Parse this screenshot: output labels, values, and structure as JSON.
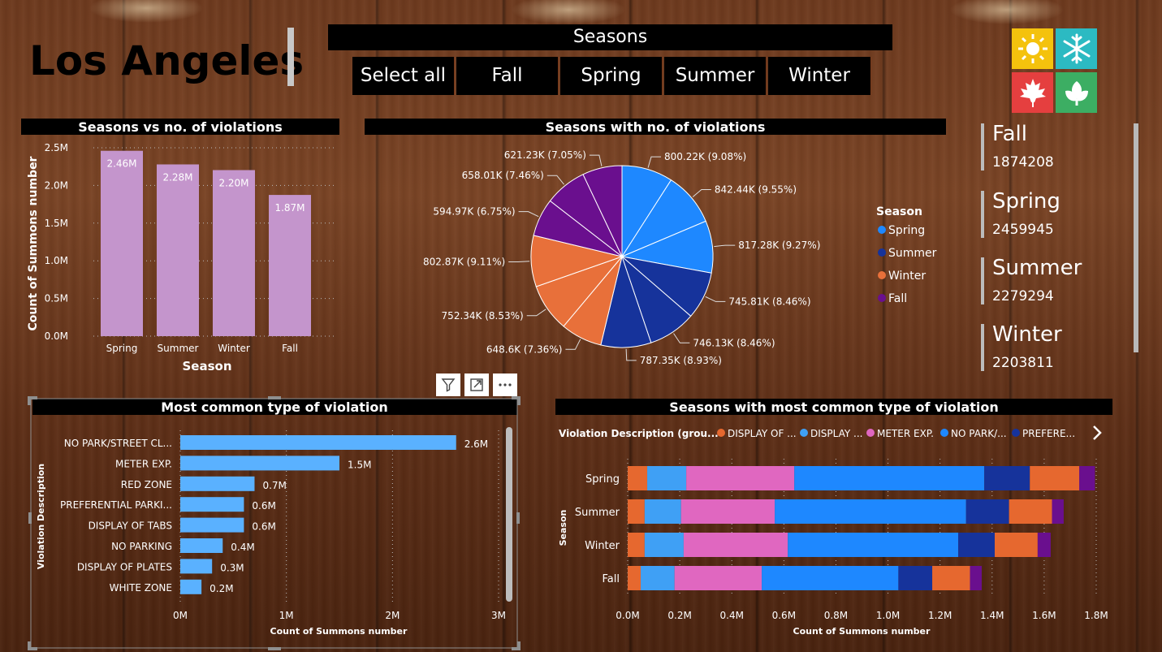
{
  "header": {
    "city": "Los Angeles"
  },
  "slicer": {
    "title": "Seasons",
    "options": [
      "Select all",
      "Fall",
      "Spring",
      "Summer",
      "Winter"
    ]
  },
  "kpis": [
    {
      "label": "Fall",
      "value": "1874208"
    },
    {
      "label": "Spring",
      "value": "2459945"
    },
    {
      "label": "Summer",
      "value": "2279294"
    },
    {
      "label": "Winter",
      "value": "2203811"
    }
  ],
  "visual_toolbar": {
    "icons": [
      "filter-icon",
      "focus-mode-icon",
      "more-options-icon"
    ]
  },
  "colors": {
    "spring": "#1e88ff",
    "summer": "#16339b",
    "winter": "#e8703a",
    "fall": "#6a0f8e",
    "bar_lilac": "#c495cc",
    "bar_light_blue": "#5ab1ff",
    "meter_pink": "#e067c0",
    "display_orange": "#e6682f",
    "display_blue": "#3fa0f5"
  },
  "chart_data": [
    {
      "type": "bar",
      "title": "Seasons vs no. of violations",
      "xlabel": "Season",
      "ylabel": "Count of Summons number",
      "categories": [
        "Spring",
        "Summer",
        "Winter",
        "Fall"
      ],
      "values": [
        2459945,
        2279294,
        2203811,
        1874208
      ],
      "data_labels": [
        "2.46M",
        "2.28M",
        "2.20M",
        "1.87M"
      ],
      "yticks": [
        "0.0M",
        "0.5M",
        "1.0M",
        "1.5M",
        "2.0M",
        "2.5M"
      ],
      "ylim": [
        0,
        2500000
      ]
    },
    {
      "type": "pie",
      "title": "Seasons with no. of violations",
      "legend_title": "Season",
      "legend": [
        "Spring",
        "Summer",
        "Winter",
        "Fall"
      ],
      "slices": [
        {
          "season": "Spring",
          "value": 800220,
          "label": "800.22K (9.08%)"
        },
        {
          "season": "Spring",
          "value": 842440,
          "label": "842.44K (9.55%)"
        },
        {
          "season": "Spring",
          "value": 817280,
          "label": "817.28K (9.27%)"
        },
        {
          "season": "Summer",
          "value": 745810,
          "label": "745.81K (8.46%)"
        },
        {
          "season": "Summer",
          "value": 746130,
          "label": "746.13K (8.46%)"
        },
        {
          "season": "Summer",
          "value": 787350,
          "label": "787.35K (8.93%)"
        },
        {
          "season": "Winter",
          "value": 648600,
          "label": "648.6K (7.36%)"
        },
        {
          "season": "Winter",
          "value": 752340,
          "label": "752.34K (8.53%)"
        },
        {
          "season": "Winter",
          "value": 802870,
          "label": "802.87K (9.11%)"
        },
        {
          "season": "Fall",
          "value": 594970,
          "label": "594.97K (6.75%)"
        },
        {
          "season": "Fall",
          "value": 658010,
          "label": "658.01K (7.46%)"
        },
        {
          "season": "Fall",
          "value": 621230,
          "label": "621.23K (7.05%)"
        }
      ]
    },
    {
      "type": "bar",
      "orientation": "horizontal",
      "title": "Most common type of violation",
      "ylabel": "Violation Description",
      "xlabel": "Count of Summons number",
      "categories": [
        "NO PARK/STREET CL...",
        "METER EXP.",
        "RED ZONE",
        "PREFERENTIAL PARKI...",
        "DISPLAY OF TABS",
        "NO PARKING",
        "DISPLAY OF PLATES",
        "WHITE ZONE"
      ],
      "values": [
        2.6,
        1.5,
        0.7,
        0.6,
        0.6,
        0.4,
        0.3,
        0.2
      ],
      "data_labels": [
        "2.6M",
        "1.5M",
        "0.7M",
        "0.6M",
        "0.6M",
        "0.4M",
        "0.3M",
        "0.2M"
      ],
      "xticks": [
        "0M",
        "1M",
        "2M",
        "3M"
      ],
      "xlim": [
        0,
        3
      ]
    },
    {
      "type": "bar",
      "orientation": "horizontal",
      "stacked": true,
      "title": "Seasons with most common type of violation",
      "legend_title": "Violation Description (grou...",
      "legend": [
        {
          "name": "DISPLAY OF ...",
          "color": "#e6682f"
        },
        {
          "name": "DISPLAY ...",
          "color": "#3fa0f5"
        },
        {
          "name": "METER EXP.",
          "color": "#e067c0"
        },
        {
          "name": "NO PARK/...",
          "color": "#1e88ff"
        },
        {
          "name": "PREFERE...",
          "color": "#16339b"
        }
      ],
      "ylabel": "Season",
      "xlabel": "Count of Summons number",
      "categories": [
        "Spring",
        "Summer",
        "Winter",
        "Fall"
      ],
      "xticks": [
        "0.0M",
        "0.2M",
        "0.4M",
        "0.6M",
        "0.8M",
        "1.0M",
        "1.2M",
        "1.4M",
        "1.6M",
        "1.8M"
      ],
      "xlim": [
        0,
        1.8
      ],
      "segment_colors": [
        "#e6682f",
        "#3fa0f5",
        "#e067c0",
        "#1e88ff",
        "#16339b",
        "#e6682f",
        "#6a0f8e"
      ],
      "rows": [
        [
          0.075,
          0.15,
          0.415,
          0.73,
          0.175,
          0.19,
          0.06
        ],
        [
          0.065,
          0.14,
          0.36,
          0.735,
          0.165,
          0.165,
          0.045
        ],
        [
          0.065,
          0.15,
          0.4,
          0.655,
          0.14,
          0.165,
          0.05
        ],
        [
          0.05,
          0.13,
          0.335,
          0.525,
          0.13,
          0.145,
          0.045
        ]
      ]
    }
  ]
}
